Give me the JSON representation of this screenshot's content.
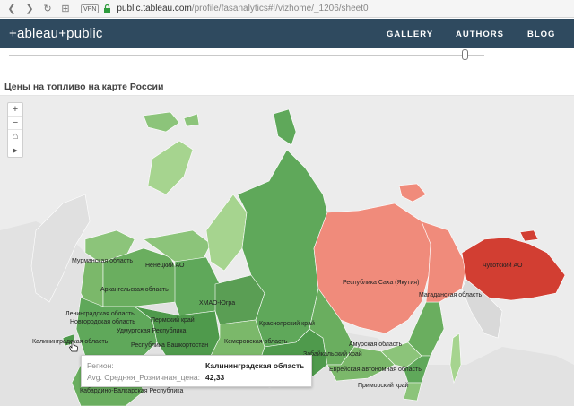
{
  "browser": {
    "vpn_label": "VPN",
    "url_host": "public.tableau.com",
    "url_path": "/profile/fasanalytics#!/vizhome/_1206/sheet0"
  },
  "header": {
    "logo_text": "+ableau+public",
    "menu": [
      "GALLERY",
      "AUTHORS",
      "BLOG"
    ]
  },
  "sheet": {
    "title": "Цены на топливо на карте России"
  },
  "map_controls": {
    "zoom_in": "+",
    "zoom_out": "−",
    "home": "⌂",
    "play": "▸"
  },
  "regions": [
    "Мурманская область",
    "Ненецкий АО",
    "Архангельская область",
    "ХМАО-Югра",
    "Ленинградская область",
    "Новгородская область",
    "Пермский край",
    "Удмуртская Республика",
    "Республика Башкортостан",
    "Калининградская область",
    "Красноярский край",
    "Кемеровская область",
    "Республика Саха (Якутия)",
    "Магаданская область",
    "Чукотский АО",
    "Амурская область",
    "Забайкальский край",
    "Еврейская автономная область",
    "Приморский край",
    "Кабардино-Балкарская Республика"
  ],
  "tooltip": {
    "region_key": "Регион:",
    "region_value": "Калининградская область",
    "price_key": "Avg. Средняя_Розничная_цена:",
    "price_value": "42,33"
  },
  "colors": {
    "header_bg": "#2f4a5f",
    "low_green": "#4f9a4c",
    "mid_green": "#7bb86a",
    "light_green": "#a6d48f",
    "salmon": "#f08b7b",
    "red": "#d23e32"
  }
}
